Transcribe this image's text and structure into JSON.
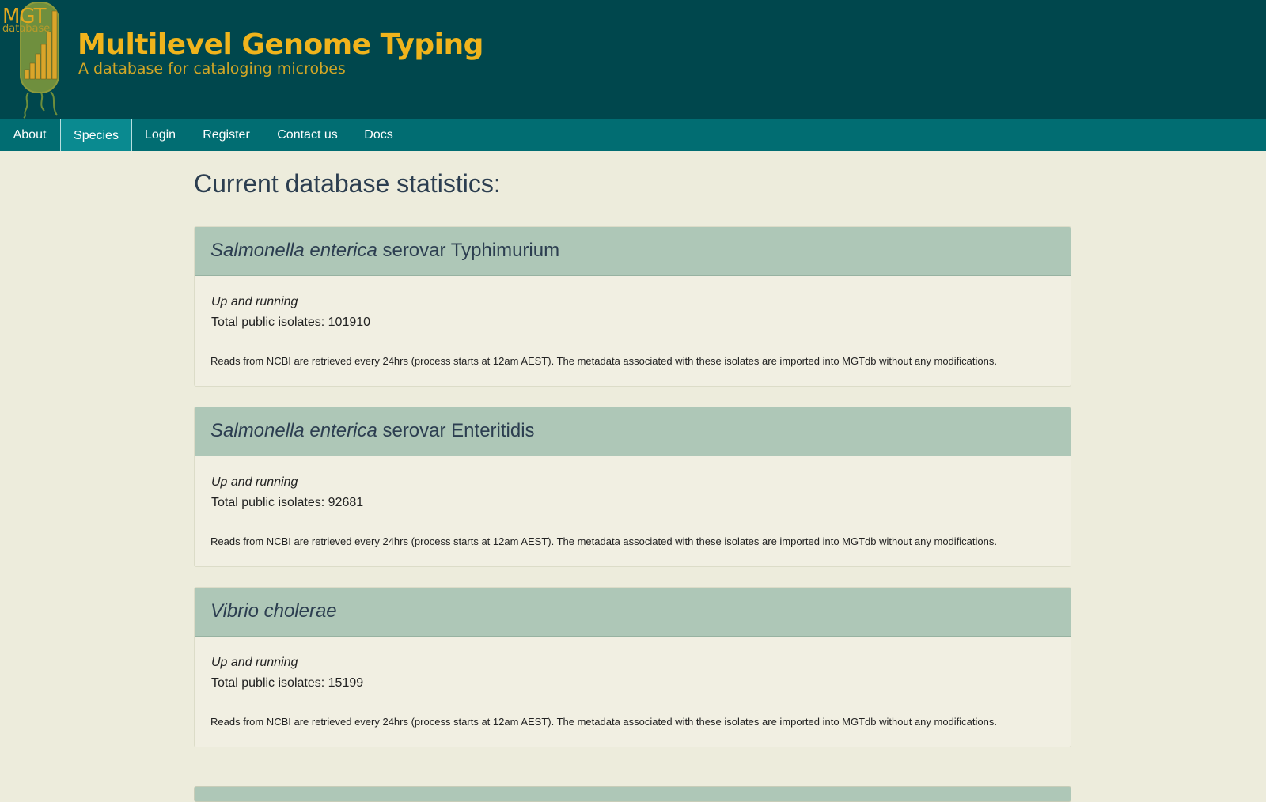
{
  "brand": {
    "logo_text": "MGT",
    "logo_subtext": "database",
    "title": "Multilevel Genome Typing",
    "subtitle": "A database for cataloging microbes"
  },
  "nav": {
    "items": [
      {
        "label": "About"
      },
      {
        "label": "Species",
        "active": true
      },
      {
        "label": "Login"
      },
      {
        "label": "Register"
      },
      {
        "label": "Contact us"
      },
      {
        "label": "Docs"
      }
    ]
  },
  "main": {
    "title": "Current database statistics:",
    "total_label": "Total public isolates:",
    "species": [
      {
        "genus_species": "Salmonella enterica",
        "serovar": "serovar Typhimurium",
        "status": "Up and running",
        "total": "101910",
        "note": "Reads from NCBI are retrieved every 24hrs (process starts at 12am AEST). The metadata associated with these isolates are imported into MGTdb without any modifications."
      },
      {
        "genus_species": "Salmonella enterica",
        "serovar": "serovar Enteritidis",
        "status": "Up and running",
        "total": "92681",
        "note": "Reads from NCBI are retrieved every 24hrs (process starts at 12am AEST). The metadata associated with these isolates are imported into MGTdb without any modifications."
      },
      {
        "genus_species": "Vibrio cholerae",
        "serovar": "",
        "status": "Up and running",
        "total": "15199",
        "note": "Reads from NCBI are retrieved every 24hrs (process starts at 12am AEST). The metadata associated with these isolates are imported into MGTdb without any modifications."
      }
    ]
  },
  "colors": {
    "header_bg": "#00474d",
    "nav_bg": "#016d72",
    "page_bg": "#edecdc",
    "panel_head_bg": "#aec7b7",
    "brand_accent": "#f0b41c"
  }
}
